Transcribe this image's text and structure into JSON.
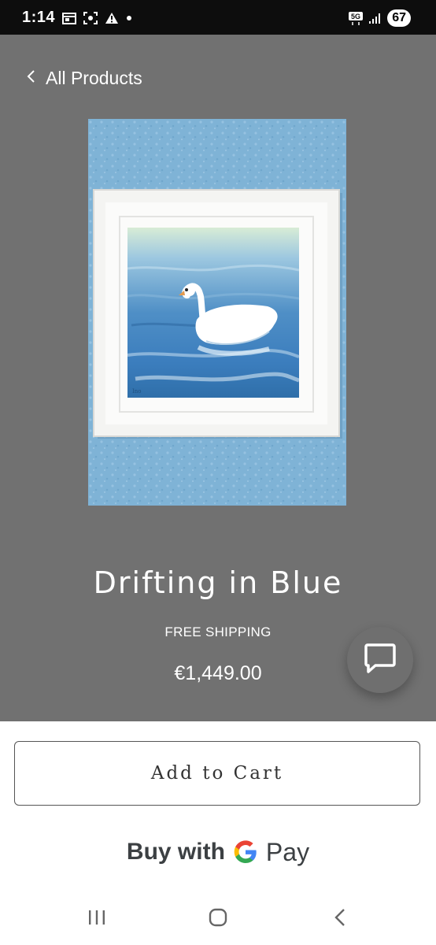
{
  "status_bar": {
    "time": "1:14",
    "battery": "67",
    "network": "5G"
  },
  "navigation": {
    "back_label": "All Products"
  },
  "product": {
    "title": "Drifting in Blue",
    "shipping": "FREE SHIPPING",
    "price": "€1,449.00"
  },
  "actions": {
    "add_to_cart": "Add to Cart",
    "gpay_prefix": "Buy with",
    "gpay_suffix": "Pay"
  },
  "icons": {
    "back": "chevron-left-icon",
    "chat": "chat-bubble-icon",
    "google": "google-g-icon",
    "nav_recents": "recents-icon",
    "nav_home": "home-icon",
    "nav_back": "back-icon"
  },
  "colors": {
    "product_background": "#717171",
    "status_bar": "#0d0d0d",
    "text_light": "#ffffff",
    "button_border": "#555555"
  }
}
